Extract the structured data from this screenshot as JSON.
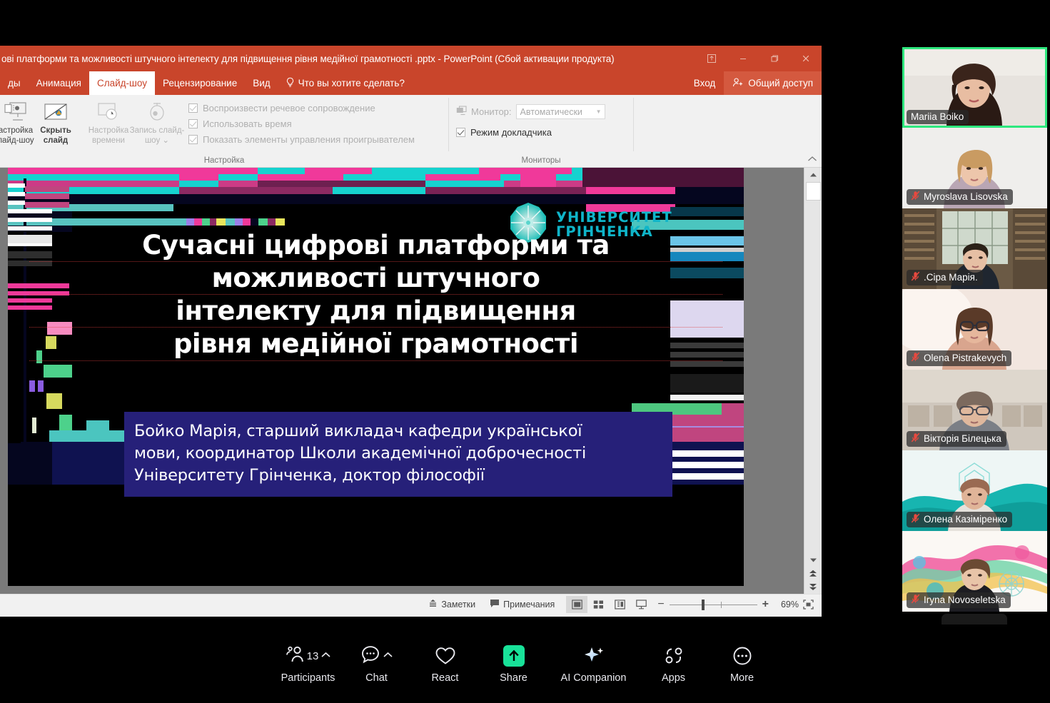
{
  "powerpoint": {
    "title": "ові платформи та можливості штучного інтелекту для підвищення рівня медійної грамотності .pptx - PowerPoint (Сбой активации продукта)",
    "window_controls": {
      "ribbon_display": "ribbon-display-options-icon",
      "minimize": "minimize-icon",
      "restore": "restore-icon",
      "close": "close-icon"
    },
    "tabs": [
      {
        "label": "ды",
        "active": false
      },
      {
        "label": "Анимация",
        "active": false
      },
      {
        "label": "Слайд-шоу",
        "active": true
      },
      {
        "label": "Рецензирование",
        "active": false
      },
      {
        "label": "Вид",
        "active": false
      }
    ],
    "tell_me": "Что вы хотите сделать?",
    "sign_in": "Вход",
    "share": "Общий доступ",
    "ribbon": {
      "groups": [
        {
          "label": "Настройка",
          "buttons": [
            {
              "caption_line1": "астройка",
              "caption_line2": "лайд-шоу",
              "dim": false,
              "icon": "setup-slideshow-icon"
            },
            {
              "caption_line1": "Скрыть",
              "caption_line2": "слайд",
              "dim": false,
              "icon": "hide-slide-icon"
            },
            {
              "caption_line1": "Настройка",
              "caption_line2": "времени",
              "dim": true,
              "icon": "rehearse-timings-icon"
            },
            {
              "caption_line1": "Запись слайд-",
              "caption_line2": "шоу ⌄",
              "dim": true,
              "icon": "record-slideshow-icon"
            }
          ],
          "checkboxes": [
            {
              "label": "Воспроизвести речевое сопровождение",
              "checked": true,
              "dim": true
            },
            {
              "label": "Использовать время",
              "checked": true,
              "dim": true
            },
            {
              "label": "Показать элементы управления проигрывателем",
              "checked": true,
              "dim": true
            }
          ]
        },
        {
          "label": "Мониторы",
          "monitor_label": "Монитор:",
          "monitor_value": "Автоматически",
          "presenter_view": {
            "label": "Режим докладчика",
            "checked": true
          }
        }
      ],
      "collapse_icon": "chevron-up-icon"
    },
    "statusbar": {
      "notes": "Заметки",
      "comments": "Примечания",
      "views": [
        {
          "name": "normal-view",
          "active": true
        },
        {
          "name": "slide-sorter-view",
          "active": false
        },
        {
          "name": "reading-view",
          "active": false
        },
        {
          "name": "slideshow-view",
          "active": false
        }
      ],
      "zoom_out": "−",
      "zoom_in": "+",
      "zoom_value": "69%",
      "fit_to_window": "fit-slide-icon"
    },
    "scrollbar": {
      "up": "scroll-up-icon",
      "down": "scroll-down-icon",
      "prev_slide": "previous-slide-icon",
      "next_slide": "next-slide-icon"
    }
  },
  "slide": {
    "logo": {
      "line1": "УНІВЕРСИТЕТ",
      "line2": "ГРІНЧЕНКА",
      "mark": "university-starburst-logo"
    },
    "title_lines": [
      "Сучасні цифрові платформи та",
      "можливості штучного",
      "інтелекту для підвищення",
      "рівня медійної грамотності"
    ],
    "subtitle_lines": [
      "Бойко Марія, старший викладач кафедри української",
      "мови, координатор Школи академічної доброчесності",
      "Університету Грінченка, доктор філософії"
    ],
    "colors": {
      "background": "#000000",
      "subtitle_box": "#262079",
      "accent_pink": "#f0399a",
      "accent_cyan": "#16d2cf",
      "logo_text": "#0fb5c9"
    }
  },
  "zoom_meeting": {
    "participants": [
      {
        "name": "Mariia Boiko",
        "muted": false,
        "active_speaker": true
      },
      {
        "name": "Myroslava Lisovska",
        "muted": true,
        "active_speaker": false
      },
      {
        "name": ".Сіра Марія.",
        "muted": true,
        "active_speaker": false
      },
      {
        "name": "Olena Pistrakevych",
        "muted": true,
        "active_speaker": false
      },
      {
        "name": "Вікторія Білецька",
        "muted": true,
        "active_speaker": false
      },
      {
        "name": "Олена Казіміренко",
        "muted": true,
        "active_speaker": false
      },
      {
        "name": "Iryna Novoseletska",
        "muted": true,
        "active_speaker": false
      }
    ],
    "collapse_strip_icon": "chevron-down-icon",
    "toolbar": [
      {
        "label": "Participants",
        "icon": "participants-icon",
        "badge": "13",
        "caret": true,
        "highlight": false
      },
      {
        "label": "Chat",
        "icon": "chat-icon",
        "badge": "",
        "caret": true,
        "highlight": false
      },
      {
        "label": "React",
        "icon": "heart-icon",
        "badge": "",
        "caret": false,
        "highlight": false
      },
      {
        "label": "Share",
        "icon": "share-screen-icon",
        "badge": "",
        "caret": false,
        "highlight": true
      },
      {
        "label": "AI Companion",
        "icon": "ai-sparkle-icon",
        "badge": "",
        "caret": false,
        "highlight": false
      },
      {
        "label": "Apps",
        "icon": "apps-icon",
        "badge": "",
        "caret": false,
        "highlight": false
      },
      {
        "label": "More",
        "icon": "more-ellipsis-icon",
        "badge": "",
        "caret": false,
        "highlight": false
      }
    ],
    "share_accent_color": "#18e299",
    "active_speaker_color": "#2ee87e"
  }
}
